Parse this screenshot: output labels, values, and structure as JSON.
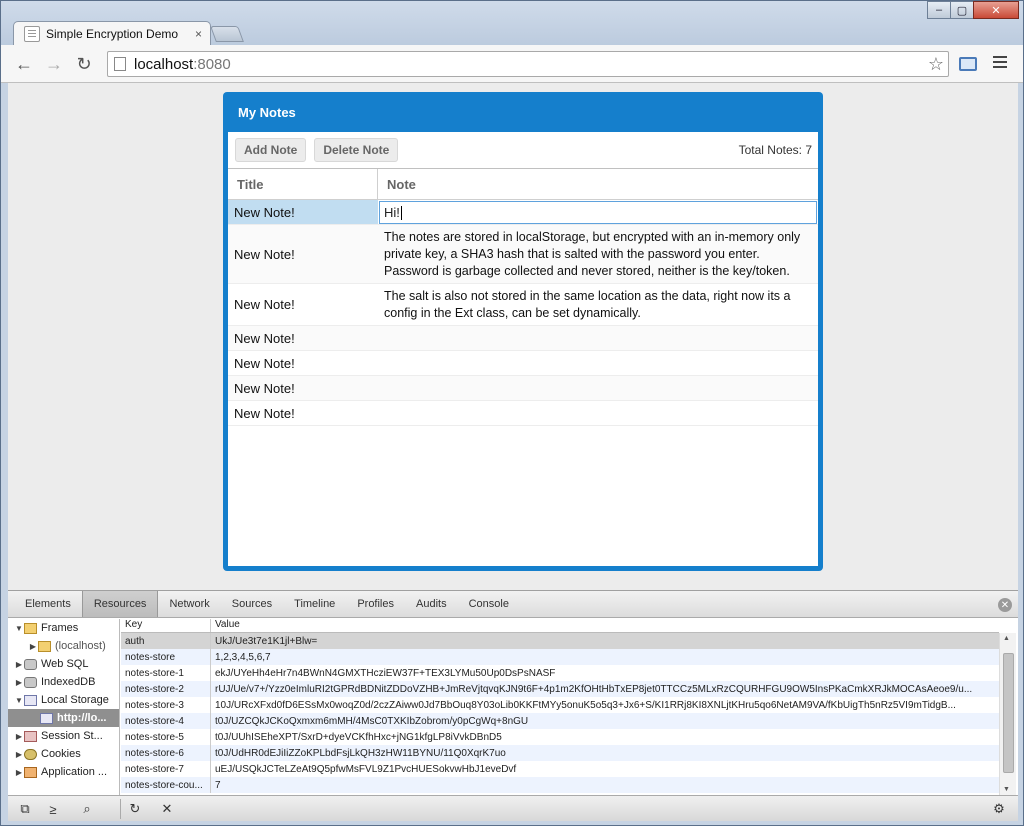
{
  "browser": {
    "tab_title": "Simple Encryption Demo",
    "tab_close": "×",
    "url_host": "localhost",
    "url_port": ":8080",
    "back": "←",
    "forward": "→",
    "reload": "↻",
    "star": "☆",
    "win_min": "–",
    "win_max": "▢",
    "win_close": "✕"
  },
  "panel": {
    "title": "My Notes",
    "add_label": "Add Note",
    "delete_label": "Delete Note",
    "total_label": "Total Notes: 7",
    "columns": [
      "Title",
      "Note"
    ],
    "rows": [
      {
        "title": "New Note!",
        "note": "Hi!"
      },
      {
        "title": "New Note!",
        "note": "The notes are stored in localStorage, but encrypted with an in-memory only private key, a SHA3 hash that is salted with the password you enter. Password is garbage collected and never stored, neither is the key/token."
      },
      {
        "title": "New Note!",
        "note": "The salt is also not stored in the same location as the data, right now its a config in the Ext class, can be set dynamically."
      },
      {
        "title": "New Note!",
        "note": ""
      },
      {
        "title": "New Note!",
        "note": ""
      },
      {
        "title": "New Note!",
        "note": ""
      },
      {
        "title": "New Note!",
        "note": ""
      }
    ]
  },
  "devtools": {
    "tabs": [
      "Elements",
      "Resources",
      "Network",
      "Sources",
      "Timeline",
      "Profiles",
      "Audits",
      "Console"
    ],
    "active_tab": "Resources",
    "tree": [
      {
        "label": "Frames",
        "tri": "▼",
        "icon": "folder",
        "indent": 0
      },
      {
        "label": "(localhost)",
        "tri": "▶",
        "icon": "folder",
        "indent": 1
      },
      {
        "label": "Web SQL",
        "tri": "▶",
        "icon": "db",
        "indent": 0
      },
      {
        "label": "IndexedDB",
        "tri": "▶",
        "icon": "db",
        "indent": 0
      },
      {
        "label": "Local Storage",
        "tri": "▼",
        "icon": "grid",
        "indent": 0
      },
      {
        "label": "http://lo...",
        "tri": "",
        "icon": "grid",
        "indent": 1
      },
      {
        "label": "Session St...",
        "tri": "▶",
        "icon": "session",
        "indent": 0
      },
      {
        "label": "Cookies",
        "tri": "▶",
        "icon": "cookies",
        "indent": 0
      },
      {
        "label": "Application ...",
        "tri": "▶",
        "icon": "appcache",
        "indent": 0
      }
    ],
    "columns": [
      "Key",
      "Value"
    ],
    "rows": [
      {
        "key": "auth",
        "value": "UkJ/Ue3t7e1K1jl+Blw="
      },
      {
        "key": "notes-store",
        "value": "1,2,3,4,5,6,7"
      },
      {
        "key": "notes-store-1",
        "value": "ekJ/UYeHh4eHr7n4BWnN4GMXTHcziEW37F+TEX3LYMu50Up0DsPsNASF"
      },
      {
        "key": "notes-store-2",
        "value": "rUJ/Ue/v7+/Yzz0eImluRI2tGPRdBDNitZDDoVZHB+JmReVjtqvqKJN9t6F+4p1m2KfOHtHbTxEP8jet0TTCCz5MLxRzCQURHFGU9OW5InsPKaCmkXRJkMOCAsAeoe9/u..."
      },
      {
        "key": "notes-store-3",
        "value": "10J/URcXFxd0fD6ESsMx0woqZ0d/2czZAiww0Jd7BbOuq8Y03oLib0KKFtMYy5onuK5o5q3+Jx6+S/KI1RRj8KI8XNLjtKHru5qo6NetAM9VA/fKbUigTh5nRz5VI9mTidgB..."
      },
      {
        "key": "notes-store-4",
        "value": "t0J/UZCQkJCKoQxmxm6mMH/4MsC0TXKIbZobrom/y0pCgWq+8nGU"
      },
      {
        "key": "notes-store-5",
        "value": "t0J/UUhISEheXPT/SxrD+dyeVCKfhHxc+jNG1kfgLP8iVvkDBnD5"
      },
      {
        "key": "notes-store-6",
        "value": "t0J/UdHR0dEJiIiZZoKPLbdFsjLkQH3zHW11BYNU/11Q0XqrK7uo"
      },
      {
        "key": "notes-store-7",
        "value": "uEJ/USQkJCTeLZeAt9Q5pfwMsFVL9Z1PvcHUESokvwHbJ1eveDvf"
      },
      {
        "key": "notes-store-cou...",
        "value": "7"
      }
    ]
  }
}
